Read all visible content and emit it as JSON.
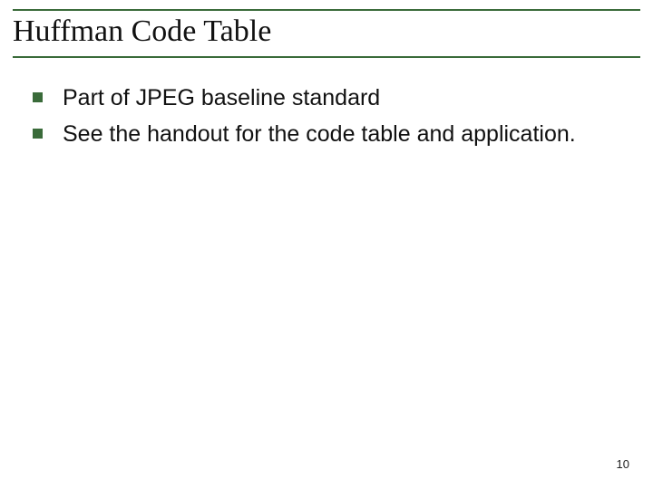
{
  "slide": {
    "title": "Huffman Code Table",
    "bullets": [
      "Part of JPEG baseline standard",
      "See the handout for the code table and application."
    ],
    "page_number": "10"
  }
}
